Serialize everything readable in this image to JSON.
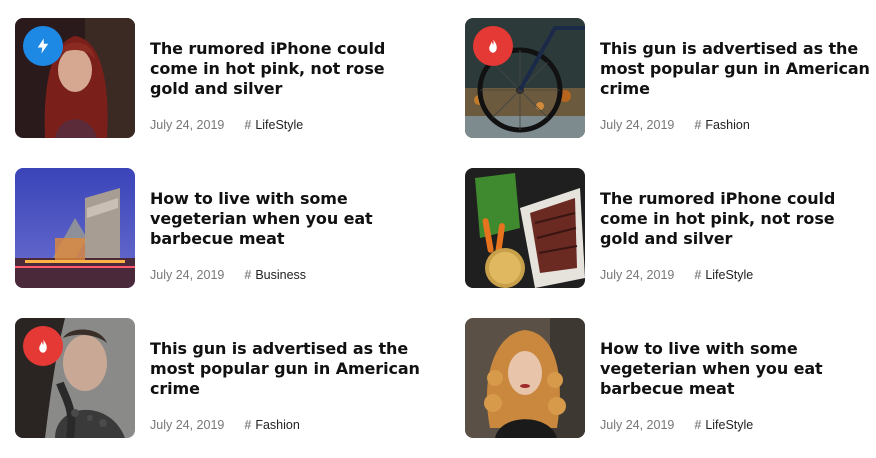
{
  "colors": {
    "badge_flash": "#1e88e5",
    "badge_fire": "#e53935"
  },
  "posts": [
    {
      "title": "The rumored iPhone could come in hot pink, not rose gold and silver",
      "date": "July 24, 2019",
      "hash": "#",
      "category": "LifeStyle",
      "image": "woman-red-hair-photo",
      "badge": "flash-icon"
    },
    {
      "title": "This gun is advertised as the most popular gun in American crime",
      "date": "July 24, 2019",
      "hash": "#",
      "category": "Fashion",
      "image": "bicycle-wheel-photo",
      "badge": "fire-icon"
    },
    {
      "title": "How to live with some vegeterian when you eat barbecue meat",
      "date": "July 24, 2019",
      "hash": "#",
      "category": "Business",
      "image": "modern-building-night-photo",
      "badge": ""
    },
    {
      "title": "The rumored iPhone could come in hot pink, not rose gold and silver",
      "date": "July 24, 2019",
      "hash": "#",
      "category": "LifeStyle",
      "image": "grilled-steak-vegetables-photo",
      "badge": ""
    },
    {
      "title": "This gun is advertised as the most popular gun in American crime",
      "date": "July 24, 2019",
      "hash": "#",
      "category": "Fashion",
      "image": "tattooed-woman-photo",
      "badge": "fire-icon"
    },
    {
      "title": "How to live with some vegeterian when you eat barbecue meat",
      "date": "July 24, 2019",
      "hash": "#",
      "category": "LifeStyle",
      "image": "woman-curly-blonde-hair-photo",
      "badge": ""
    }
  ]
}
